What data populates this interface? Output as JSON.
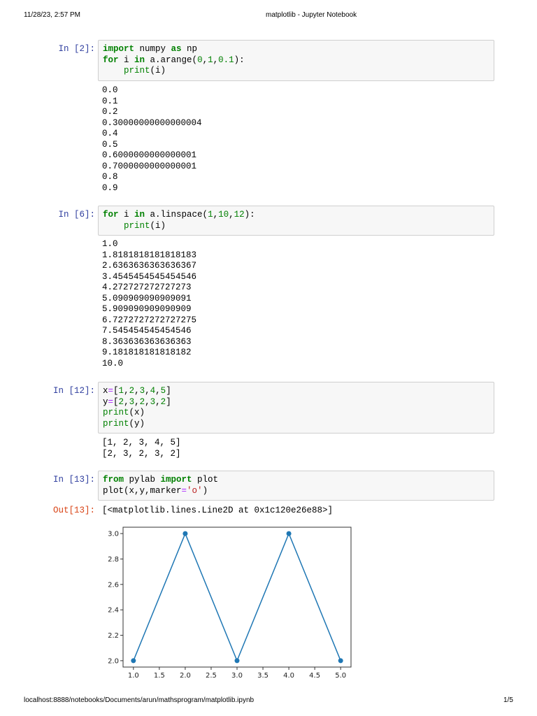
{
  "header": {
    "datetime": "11/28/23, 2:57 PM",
    "title": "matplotlib - Jupyter Notebook"
  },
  "footer": {
    "url": "localhost:8888/notebooks/Documents/arun/mathsprogram/matplotlib.ipynb",
    "page": "1/5"
  },
  "cells": [
    {
      "prompt": "In [2]:",
      "code": [
        [
          [
            "import",
            "kw"
          ],
          [
            " numpy ",
            "plain"
          ],
          [
            "as",
            "kw"
          ],
          [
            " np",
            "plain"
          ]
        ],
        [
          [
            "for",
            "kw"
          ],
          [
            " i ",
            "plain"
          ],
          [
            "in",
            "kw"
          ],
          [
            " a.arange(",
            "plain"
          ],
          [
            "0",
            "num"
          ],
          [
            ",",
            "plain"
          ],
          [
            "1",
            "num"
          ],
          [
            ",",
            "plain"
          ],
          [
            "0.1",
            "num"
          ],
          [
            "):",
            "plain"
          ]
        ],
        [
          [
            "    ",
            "plain"
          ],
          [
            "print",
            "bi"
          ],
          [
            "(i)",
            "plain"
          ]
        ]
      ],
      "output": [
        "0.0",
        "0.1",
        "0.2",
        "0.30000000000000004",
        "0.4",
        "0.5",
        "0.6000000000000001",
        "0.7000000000000001",
        "0.8",
        "0.9"
      ]
    },
    {
      "prompt": "In [6]:",
      "code": [
        [
          [
            "for",
            "kw"
          ],
          [
            " i ",
            "plain"
          ],
          [
            "in",
            "kw"
          ],
          [
            " a.linspace(",
            "plain"
          ],
          [
            "1",
            "num"
          ],
          [
            ",",
            "plain"
          ],
          [
            "10",
            "num"
          ],
          [
            ",",
            "plain"
          ],
          [
            "12",
            "num"
          ],
          [
            "):",
            "plain"
          ]
        ],
        [
          [
            "    ",
            "plain"
          ],
          [
            "print",
            "bi"
          ],
          [
            "(i)",
            "plain"
          ]
        ]
      ],
      "output": [
        "1.0",
        "1.8181818181818183",
        "2.6363636363636367",
        "3.4545454545454546",
        "4.272727272727273",
        "5.090909090909091",
        "5.909090909090909",
        "6.7272727272727275",
        "7.545454545454546",
        "8.363636363636363",
        "9.181818181818182",
        "10.0"
      ]
    },
    {
      "prompt": "In [12]:",
      "code": [
        [
          [
            "x",
            "plain"
          ],
          [
            "=",
            "op"
          ],
          [
            "[",
            "plain"
          ],
          [
            "1",
            "num"
          ],
          [
            ",",
            "plain"
          ],
          [
            "2",
            "num"
          ],
          [
            ",",
            "plain"
          ],
          [
            "3",
            "num"
          ],
          [
            ",",
            "plain"
          ],
          [
            "4",
            "num"
          ],
          [
            ",",
            "plain"
          ],
          [
            "5",
            "num"
          ],
          [
            "]",
            "plain"
          ]
        ],
        [
          [
            "y",
            "plain"
          ],
          [
            "=",
            "op"
          ],
          [
            "[",
            "plain"
          ],
          [
            "2",
            "num"
          ],
          [
            ",",
            "plain"
          ],
          [
            "3",
            "num"
          ],
          [
            ",",
            "plain"
          ],
          [
            "2",
            "num"
          ],
          [
            ",",
            "plain"
          ],
          [
            "3",
            "num"
          ],
          [
            ",",
            "plain"
          ],
          [
            "2",
            "num"
          ],
          [
            "]",
            "plain"
          ]
        ],
        [
          [
            "print",
            "bi"
          ],
          [
            "(x)",
            "plain"
          ]
        ],
        [
          [
            "print",
            "bi"
          ],
          [
            "(y)",
            "plain"
          ]
        ]
      ],
      "output": [
        "[1, 2, 3, 4, 5]",
        "[2, 3, 2, 3, 2]"
      ]
    },
    {
      "prompt": "In [13]:",
      "code": [
        [
          [
            "from",
            "kw"
          ],
          [
            " pylab ",
            "plain"
          ],
          [
            "import",
            "kw"
          ],
          [
            " plot",
            "plain"
          ]
        ],
        [
          [
            "plot(x,y,marker",
            "plain"
          ],
          [
            "=",
            "op"
          ],
          [
            "'o'",
            "str"
          ],
          [
            ")",
            "plain"
          ]
        ]
      ],
      "out_prompt": "Out[13]:",
      "output": [
        "[<matplotlib.lines.Line2D at 0x1c120e26e88>]"
      ]
    }
  ],
  "chart_data": {
    "type": "line",
    "x": [
      1,
      2,
      3,
      4,
      5
    ],
    "y": [
      2,
      3,
      2,
      3,
      2
    ],
    "marker": "o",
    "color": "#1f77b4",
    "xlim": [
      0.8,
      5.2
    ],
    "ylim": [
      1.95,
      3.05
    ],
    "xticks": [
      "1.0",
      "1.5",
      "2.0",
      "2.5",
      "3.0",
      "3.5",
      "4.0",
      "4.5",
      "5.0"
    ],
    "yticks": [
      "2.0",
      "2.2",
      "2.4",
      "2.6",
      "2.8",
      "3.0"
    ],
    "title": "",
    "xlabel": "",
    "ylabel": ""
  }
}
